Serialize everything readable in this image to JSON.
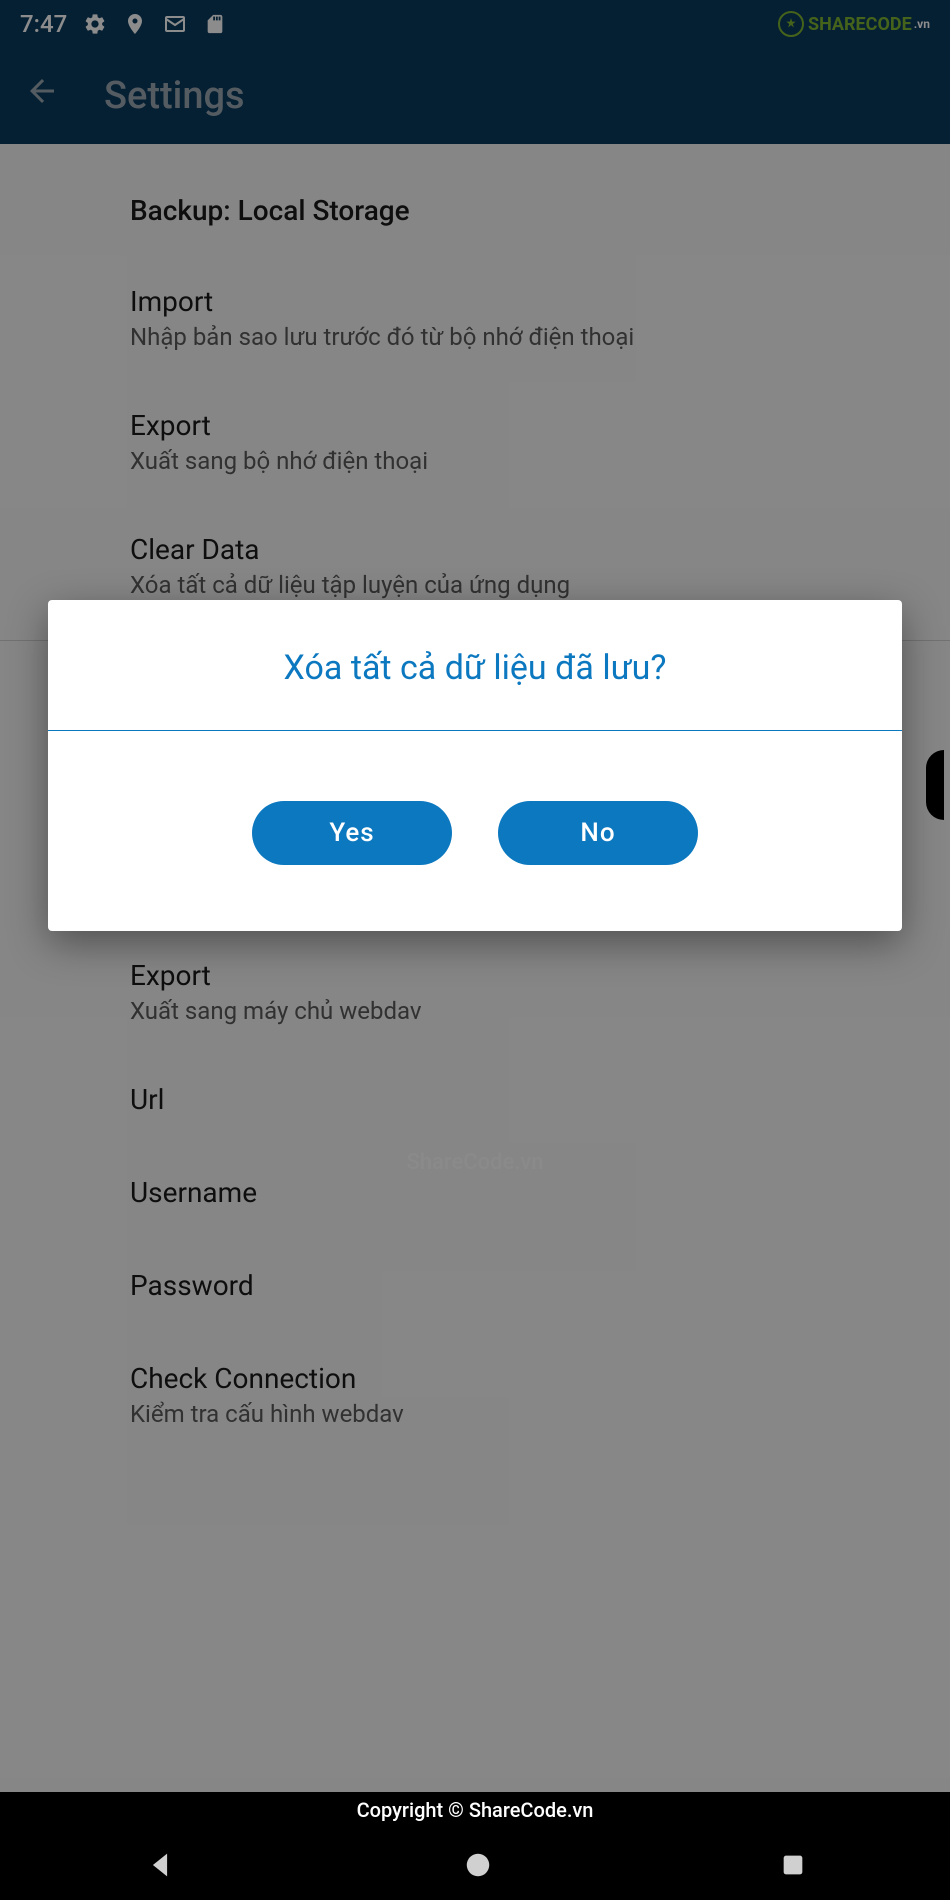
{
  "status_bar": {
    "time": "7:47",
    "logo_text": "SHARECODE",
    "logo_suffix": ".vn"
  },
  "app_bar": {
    "title": "Settings"
  },
  "section1": {
    "header": "Backup: Local Storage",
    "items": [
      {
        "title": "Import",
        "subtitle": "Nhập bản sao lưu trước đó từ bộ nhớ điện thoại"
      },
      {
        "title": "Export",
        "subtitle": "Xuất sang bộ nhớ điện thoại"
      },
      {
        "title": "Clear Data",
        "subtitle": "Xóa tất cả dữ liệu tập luyện của ứng dụng"
      }
    ]
  },
  "section2": {
    "items": [
      {
        "title": "Export",
        "subtitle": "Xuất sang máy chủ webdav"
      },
      {
        "title": "Url",
        "subtitle": ""
      },
      {
        "title": "Username",
        "subtitle": ""
      },
      {
        "title": "Password",
        "subtitle": ""
      },
      {
        "title": "Check Connection",
        "subtitle": "Kiểm tra cấu hình webdav"
      }
    ]
  },
  "dialog": {
    "title": "Xóa tất cả dữ liệu đã lưu?",
    "yes": "Yes",
    "no": "No"
  },
  "watermark": "ShareCode.vn",
  "copyright": "Copyright © ShareCode.vn"
}
